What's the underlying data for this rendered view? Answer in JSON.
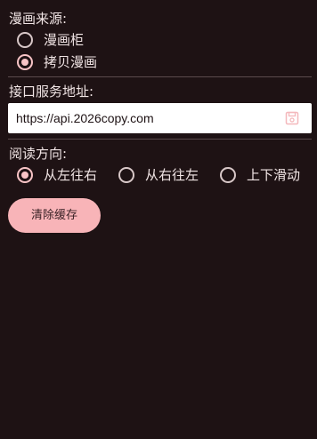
{
  "source": {
    "label": "漫画来源:",
    "options": [
      {
        "label": "漫画柜",
        "selected": false
      },
      {
        "label": "拷贝漫画",
        "selected": true
      }
    ]
  },
  "api": {
    "label": "接口服务地址:",
    "value": "https://api.2026copy.com",
    "save_icon": "save-icon"
  },
  "reading": {
    "label": "阅读方向:",
    "options": [
      {
        "label": "从左往右",
        "selected": true
      },
      {
        "label": "从右往左",
        "selected": false
      },
      {
        "label": "上下滑动",
        "selected": false
      }
    ]
  },
  "actions": {
    "clear_cache_label": "清除缓存"
  },
  "colors": {
    "background": "#1e1214",
    "accent": "#f8c4c6",
    "button": "#f8b4b8",
    "divider": "#5a4a4c"
  }
}
